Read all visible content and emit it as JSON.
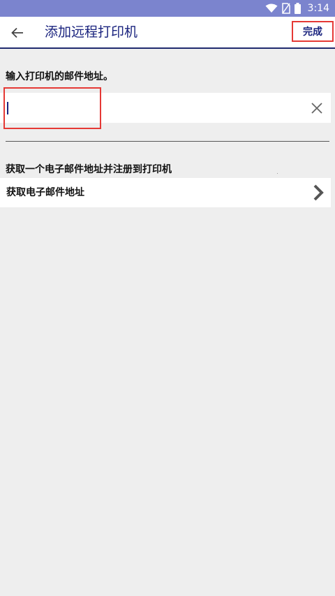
{
  "status_bar": {
    "time": "3:14",
    "icons": [
      "wifi-icon",
      "no-sim-icon",
      "battery-icon"
    ],
    "color": "#7b84ce"
  },
  "app_bar": {
    "title": "添加远程打印机",
    "done_label": "完成",
    "back_icon": "arrow-back-icon",
    "accent": "#1a237e"
  },
  "email_section": {
    "label": "输入打印机的邮件地址。",
    "input_value": "",
    "clear_icon": "close-icon"
  },
  "get_email_section": {
    "label": "获取一个电子邮件地址并注册到打印机",
    "item_label": "获取电子邮件地址",
    "chevron_icon": "chevron-right-icon"
  },
  "highlight_color": "#e53935"
}
